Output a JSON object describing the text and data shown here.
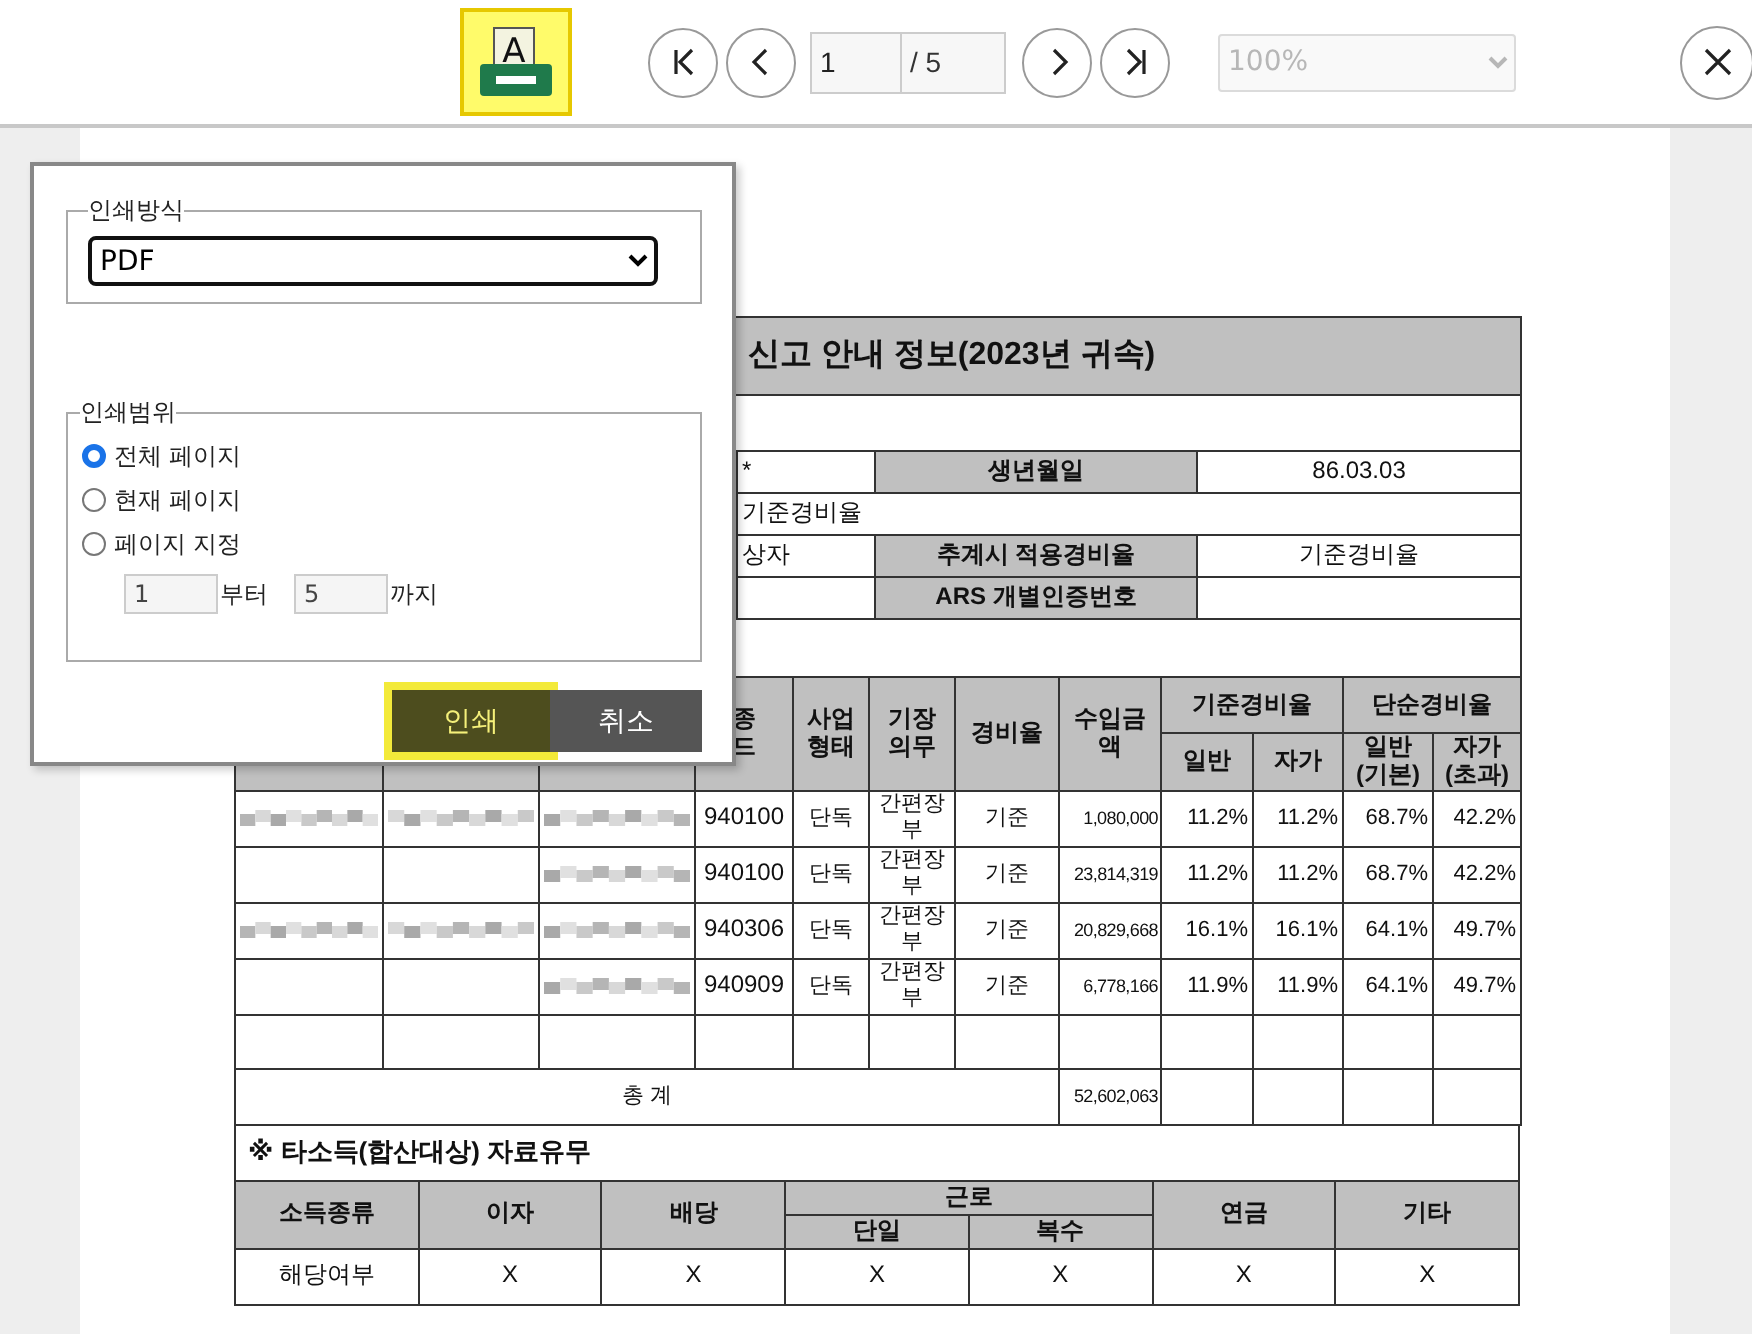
{
  "toolbar": {
    "print_button": {
      "icon_text": "A",
      "focused": true
    },
    "page_input": "1",
    "page_total": "/ 5",
    "zoom": {
      "value": "100%",
      "disabled": true
    }
  },
  "document": {
    "title": "신고 안내 정보(2023년 귀속)",
    "info_rows": [
      {
        "value": "*",
        "label": "생년월일",
        "value_2": "86.03.03"
      },
      {
        "value": "기준경비율"
      },
      {
        "value": "상자",
        "label": "추계시 적용경비율",
        "value_2": "기준경비율"
      },
      {
        "label": "ARS 개별인증번호"
      }
    ],
    "income_table": {
      "columns": [
        {
          "kind": "hidden"
        },
        {
          "kind": "hidden"
        },
        {
          "kind": "hidden"
        },
        {
          "kind": "label",
          "label": "종\n드"
        },
        {
          "kind": "label",
          "label": "사업\n형태"
        },
        {
          "kind": "label",
          "label": "기장\n의무"
        },
        {
          "kind": "label",
          "label": "경비율"
        },
        {
          "kind": "label",
          "label": "수입금액"
        },
        {
          "kind": "group",
          "label": "기준경비율",
          "children": [
            "일반",
            "자가"
          ]
        },
        {
          "kind": "group",
          "label": "단순경비율",
          "children": [
            "일반\n(기본)",
            "자가\n(초과)"
          ]
        }
      ],
      "rows": [
        {
          "kind": "data",
          "masked": [
            true,
            true,
            true
          ],
          "cells": [
            "940100",
            "단독",
            "간편장부",
            "기준",
            "1,080,000",
            "11.2%",
            "11.2%",
            "68.7%",
            "42.2%"
          ]
        },
        {
          "kind": "data",
          "masked": [
            false,
            false,
            true
          ],
          "cells": [
            "940100",
            "단독",
            "간편장부",
            "기준",
            "23,814,319",
            "11.2%",
            "11.2%",
            "68.7%",
            "42.2%"
          ]
        },
        {
          "kind": "data",
          "masked": [
            true,
            true,
            true
          ],
          "cells": [
            "940306",
            "단독",
            "간편장부",
            "기준",
            "20,829,668",
            "16.1%",
            "16.1%",
            "64.1%",
            "49.7%"
          ]
        },
        {
          "kind": "data",
          "masked": [
            false,
            false,
            true
          ],
          "cells": [
            "940909",
            "단독",
            "간편장부",
            "기준",
            "6,778,166",
            "11.9%",
            "11.9%",
            "64.1%",
            "49.7%"
          ]
        },
        {
          "kind": "blank"
        },
        {
          "kind": "total",
          "label": "총 계",
          "amount": "52,602,063"
        }
      ]
    },
    "other_income": {
      "heading": "※ 타소득(합산대상) 자료유무",
      "columns": [
        {
          "label": "소득종류"
        },
        {
          "label": "이자"
        },
        {
          "label": "배당"
        },
        {
          "label": "근로",
          "children": [
            "단일",
            "복수"
          ]
        },
        {
          "label": "연금"
        },
        {
          "label": "기타"
        }
      ],
      "row": [
        "해당여부",
        "X",
        "X",
        "X",
        "X",
        "X",
        "X"
      ]
    }
  },
  "print_dialog": {
    "method_legend": "인쇄방식",
    "method": "PDF",
    "range_legend": "인쇄범위",
    "range_options": [
      {
        "label": "전체 페이지",
        "selected": true
      },
      {
        "label": "현재 페이지",
        "selected": false
      },
      {
        "label": "페이지 지정",
        "selected": false
      }
    ],
    "from_value": "1",
    "from_label": "부터",
    "to_value": "5",
    "to_label": "까지",
    "buttons": [
      {
        "kind": "primary",
        "label": "인쇄",
        "focused": true
      },
      {
        "kind": "secondary",
        "label": "취소",
        "focused": false
      }
    ]
  }
}
